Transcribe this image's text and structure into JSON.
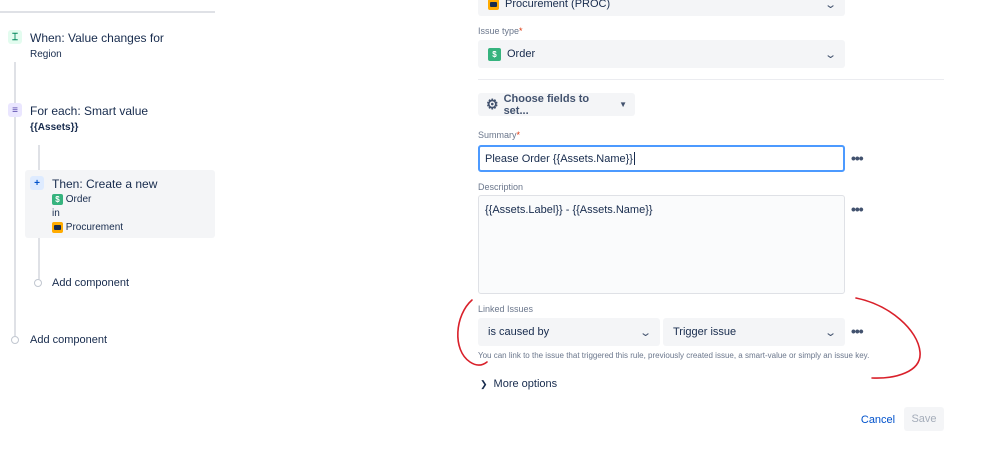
{
  "rule": {
    "trigger": {
      "title": "When: Value changes for",
      "subtitle": "Region"
    },
    "branch": {
      "title": "For each: Smart value",
      "subtitle": "{{Assets}}"
    },
    "action": {
      "title": "Then: Create a new",
      "issue_type": "Order",
      "in_label": "in",
      "project": "Procurement"
    },
    "add_component_inner": "Add component",
    "add_component_outer": "Add component"
  },
  "form": {
    "project_value": "Procurement (PROC)",
    "issue_type": {
      "label": "Issue type",
      "required_mark": "*",
      "value": "Order"
    },
    "choose_fields_label": "Choose fields to set...",
    "summary": {
      "label": "Summary",
      "required_mark": "*",
      "value": "Please Order {{Assets.Name}}"
    },
    "description": {
      "label": "Description",
      "value": "{{Assets.Label}} - {{Assets.Name}}"
    },
    "linked_issues": {
      "label": "Linked Issues",
      "link_type": "is caused by",
      "target": "Trigger issue",
      "help": "You can link to the issue that triggered this rule, previously created issue, a smart-value or simply an issue key."
    },
    "more_options_label": "More options",
    "more_menu_glyph": "•••",
    "cancel_label": "Cancel",
    "save_label": "Save"
  },
  "colors": {
    "annotation": "#d9202a",
    "primary": "#0052cc",
    "focus": "#4c9aff"
  }
}
